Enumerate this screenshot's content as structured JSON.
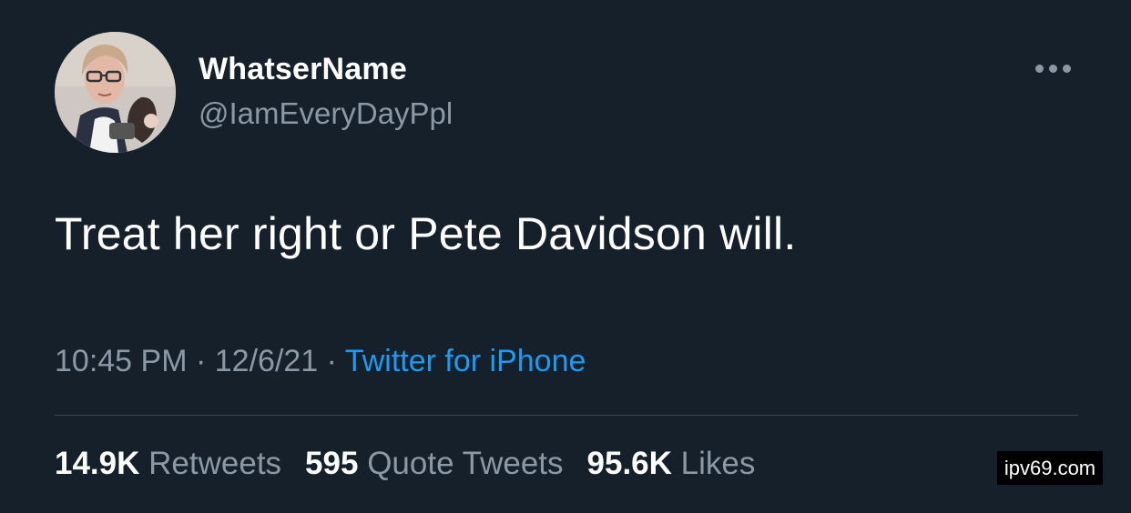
{
  "tweet": {
    "author_name": "WhatserName",
    "author_handle": "@IamEveryDayPpl",
    "text": "Treat her right or Pete Davidson will.",
    "time": "10:45 PM",
    "date": "12/6/21",
    "separator": "·",
    "source": "Twitter for iPhone",
    "more_icon": "more-horizontal-icon"
  },
  "stats": {
    "retweets": {
      "count": "14.9K",
      "label": "Retweets"
    },
    "quote_tweets": {
      "count": "595",
      "label": "Quote Tweets"
    },
    "likes": {
      "count": "95.6K",
      "label": "Likes"
    }
  },
  "watermark": "ipv69.com",
  "colors": {
    "background": "#15202b",
    "text_primary": "#ffffff",
    "text_secondary": "#8b98a5",
    "link": "#1d9bf0",
    "divider": "#38444d"
  }
}
